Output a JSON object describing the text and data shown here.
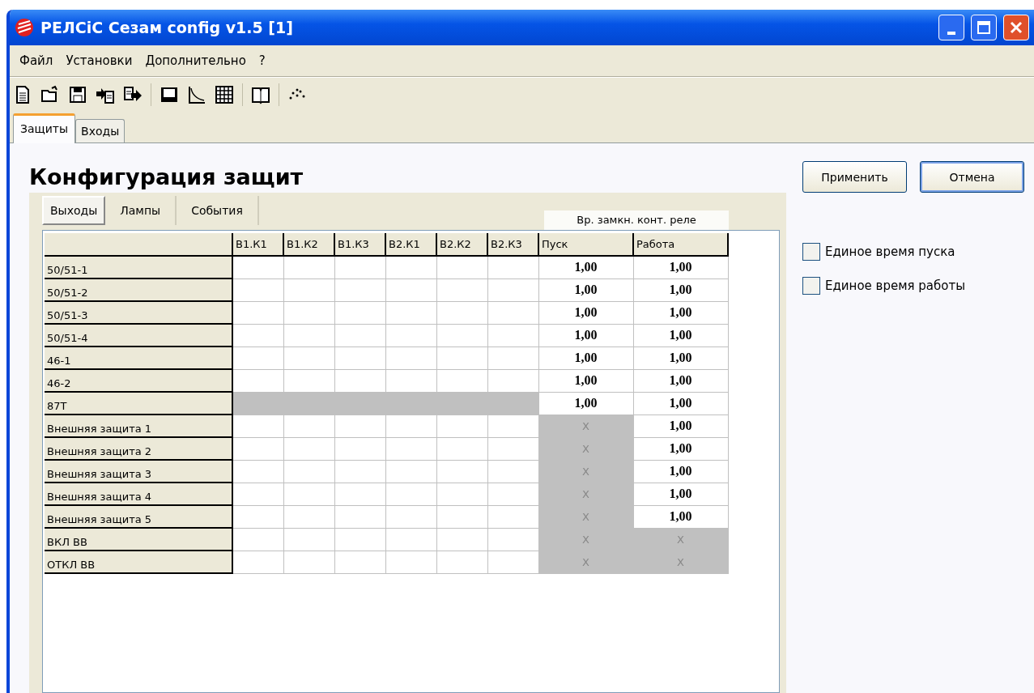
{
  "window": {
    "title": "РЕЛСіС Сезам config v1.5 [1]"
  },
  "menu": [
    "Файл",
    "Установки",
    "Дополнительно",
    "?"
  ],
  "tabs": [
    {
      "label": "Защиты",
      "selected": true
    },
    {
      "label": "Входы",
      "selected": false
    }
  ],
  "heading": "Конфигурация защит",
  "subtabs": [
    {
      "label": "Выходы",
      "selected": true
    },
    {
      "label": "Лампы",
      "selected": false
    },
    {
      "label": "События",
      "selected": false
    }
  ],
  "group_header": "Вр. замкн. конт. реле",
  "columns": [
    "В1.К1",
    "В1.К2",
    "В1.К3",
    "В2.К1",
    "В2.К2",
    "В2.К3",
    "Пуск",
    "Работа"
  ],
  "rows": [
    {
      "name": "50/51-1",
      "outputs_disabled": false,
      "start": {
        "text": "1,00",
        "disabled": false
      },
      "work": {
        "text": "1,00",
        "disabled": false
      }
    },
    {
      "name": "50/51-2",
      "outputs_disabled": false,
      "start": {
        "text": "1,00",
        "disabled": false
      },
      "work": {
        "text": "1,00",
        "disabled": false
      }
    },
    {
      "name": "50/51-3",
      "outputs_disabled": false,
      "start": {
        "text": "1,00",
        "disabled": false
      },
      "work": {
        "text": "1,00",
        "disabled": false
      }
    },
    {
      "name": "50/51-4",
      "outputs_disabled": false,
      "start": {
        "text": "1,00",
        "disabled": false
      },
      "work": {
        "text": "1,00",
        "disabled": false
      }
    },
    {
      "name": "46-1",
      "outputs_disabled": false,
      "start": {
        "text": "1,00",
        "disabled": false
      },
      "work": {
        "text": "1,00",
        "disabled": false
      }
    },
    {
      "name": "46-2",
      "outputs_disabled": false,
      "start": {
        "text": "1,00",
        "disabled": false
      },
      "work": {
        "text": "1,00",
        "disabled": false
      }
    },
    {
      "name": "87T",
      "outputs_disabled": true,
      "start": {
        "text": "1,00",
        "disabled": false
      },
      "work": {
        "text": "1,00",
        "disabled": false
      }
    },
    {
      "name": "Внешняя защита 1",
      "outputs_disabled": false,
      "start": {
        "text": "X",
        "disabled": true
      },
      "work": {
        "text": "1,00",
        "disabled": false
      }
    },
    {
      "name": "Внешняя защита 2",
      "outputs_disabled": false,
      "start": {
        "text": "X",
        "disabled": true
      },
      "work": {
        "text": "1,00",
        "disabled": false
      }
    },
    {
      "name": "Внешняя защита 3",
      "outputs_disabled": false,
      "start": {
        "text": "X",
        "disabled": true
      },
      "work": {
        "text": "1,00",
        "disabled": false
      }
    },
    {
      "name": "Внешняя защита 4",
      "outputs_disabled": false,
      "start": {
        "text": "X",
        "disabled": true
      },
      "work": {
        "text": "1,00",
        "disabled": false
      }
    },
    {
      "name": "Внешняя защита 5",
      "outputs_disabled": false,
      "start": {
        "text": "X",
        "disabled": true
      },
      "work": {
        "text": "1,00",
        "disabled": false
      }
    },
    {
      "name": "ВКЛ ВВ",
      "outputs_disabled": false,
      "start": {
        "text": "X",
        "disabled": true
      },
      "work": {
        "text": "X",
        "disabled": true
      }
    },
    {
      "name": "ОТКЛ ВВ",
      "outputs_disabled": false,
      "start": {
        "text": "X",
        "disabled": true
      },
      "work": {
        "text": "X",
        "disabled": true
      }
    }
  ],
  "buttons": [
    {
      "label": "Применить",
      "default": false
    },
    {
      "label": "Отмена",
      "default": true
    }
  ],
  "checkboxes": [
    {
      "label": "Единое время пуска",
      "checked": false
    },
    {
      "label": "Единое время работы",
      "checked": false
    }
  ]
}
